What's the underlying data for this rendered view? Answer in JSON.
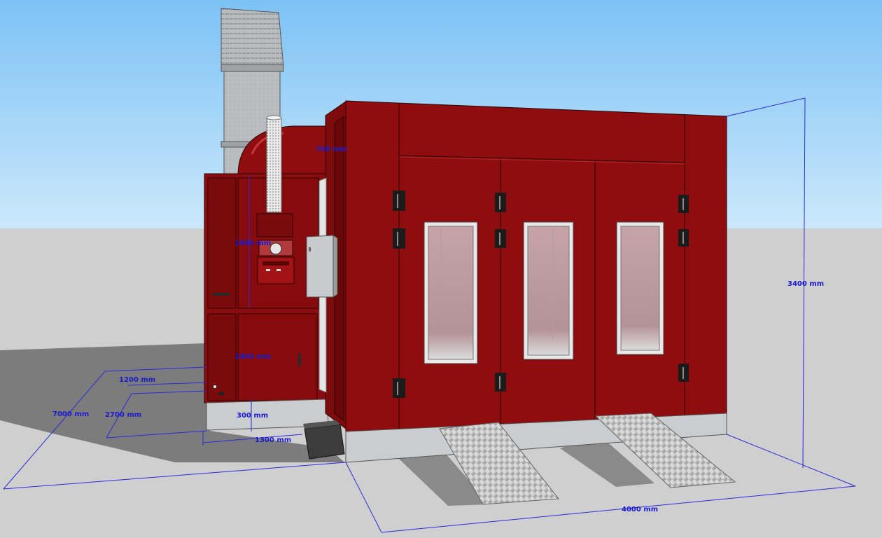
{
  "dimensions": {
    "overall_length": "7000 mm",
    "front_width": "4000 mm",
    "height": "3400 mm",
    "heater_depth": "1200 mm",
    "heater_width": "2700 mm",
    "heater_base": "300 mm",
    "heater_length": "1300 mm",
    "label_faint_1": "700 mm",
    "label_faint_2": "1800 mm",
    "label_faint_3": "1800 mm"
  },
  "colors": {
    "sky_top": "#7dc2f5",
    "sky_bottom": "#c8e6fb",
    "ground": "#cfcfcf",
    "booth_red": "#8f0d0f",
    "booth_red_dark": "#6d0709",
    "steel": "#bfc3c6",
    "dimension_blue": "#1a1ad0"
  },
  "icons": [
    "hinge-icon",
    "gauge-icon",
    "ramp-pattern"
  ]
}
